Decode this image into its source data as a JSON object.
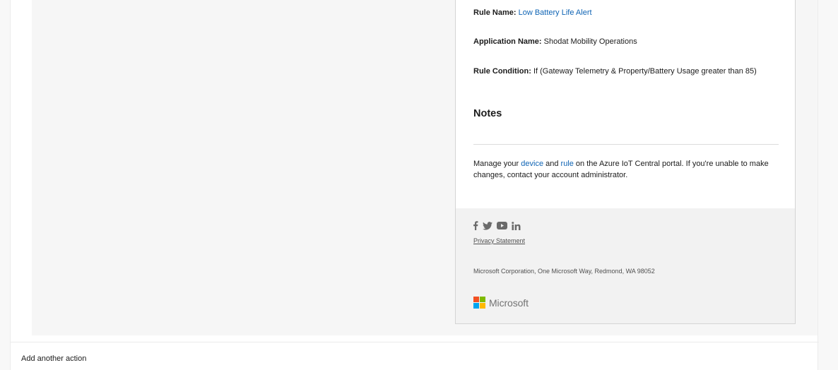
{
  "email": {
    "rule_name_label": "Rule Name:",
    "rule_name_value": "Low Battery Life Alert",
    "application_name_label": "Application Name:",
    "application_name_value": "Shodat Mobility Operations",
    "rule_condition_label": "Rule Condition:",
    "rule_condition_value": "If (Gateway Telemetry & Property/Battery Usage greater than 85)",
    "notes_title": "Notes",
    "manage": {
      "prefix": "Manage your ",
      "device_link": "device",
      "and": " and ",
      "rule_link": "rule",
      "suffix": " on the Azure IoT Central portal. If you're unable to make changes, contact your account administrator."
    }
  },
  "footer": {
    "social_icons": [
      "facebook-icon",
      "twitter-icon",
      "youtube-icon",
      "linkedin-icon"
    ],
    "privacy_label": "Privacy Statement",
    "address": "Microsoft Corporation, One Microsoft Way, Redmond, WA 98052",
    "brand_name": "Microsoft",
    "brand_colors": [
      "#f25022",
      "#7fba00",
      "#00a4ef",
      "#ffb900"
    ]
  },
  "actions": {
    "add_another_action": "Add another action"
  },
  "colors": {
    "link": "#0f64b4",
    "preview_background": "#f6f6f6",
    "footer_background": "#f2f2f2"
  }
}
